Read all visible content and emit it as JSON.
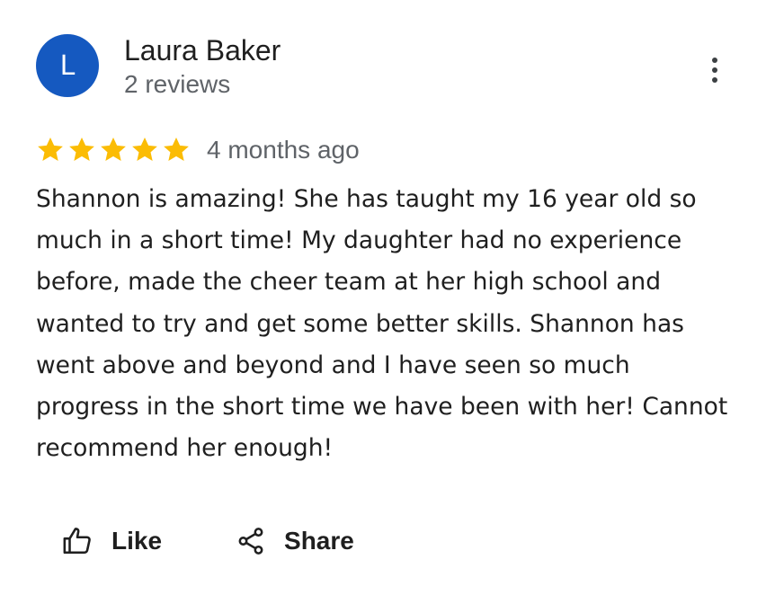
{
  "reviewer": {
    "avatar_initial": "L",
    "avatar_color": "#1559c0",
    "name": "Laura Baker",
    "review_count": "2 reviews"
  },
  "menu": {
    "icon": "more-vert-icon"
  },
  "review": {
    "rating": 5,
    "rating_max": 5,
    "star_color": "#fbbc04",
    "date": "4 months ago",
    "text": "Shannon is amazing! She has taught my 16 year old so much in a short time! My daughter had no experience before, made the cheer team at her high school and wanted to try and get some better skills. Shannon has went above and beyond and I have seen so much progress in the short time we have been with her! Cannot recommend her enough!"
  },
  "actions": {
    "like_label": "Like",
    "like_icon": "thumb-up-icon",
    "share_label": "Share",
    "share_icon": "share-icon"
  }
}
